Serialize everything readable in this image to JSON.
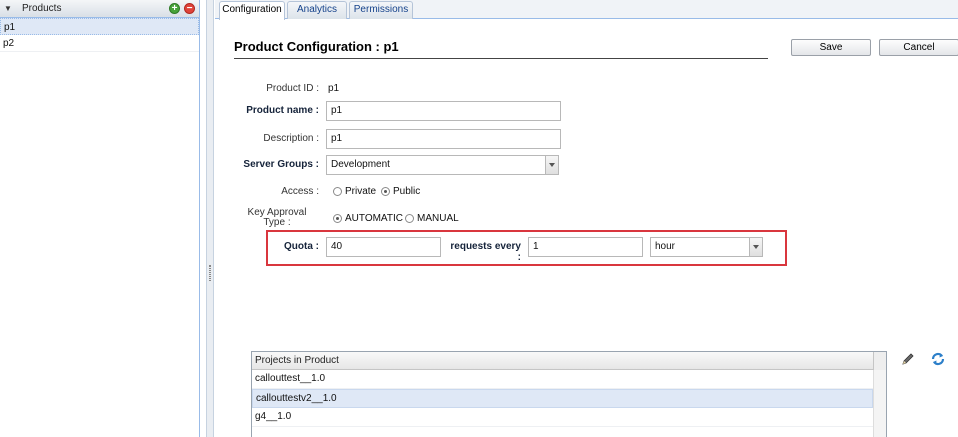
{
  "left_panel": {
    "title": "Products",
    "items": [
      {
        "label": "p1",
        "selected": true
      },
      {
        "label": "p2",
        "selected": false
      }
    ]
  },
  "tabs": [
    {
      "label": "Configuration",
      "active": true
    },
    {
      "label": "Analytics",
      "active": false
    },
    {
      "label": "Permissions",
      "active": false
    }
  ],
  "page": {
    "title": "Product Configuration : p1",
    "save_label": "Save",
    "cancel_label": "Cancel"
  },
  "form": {
    "product_id_label": "Product ID :",
    "product_id_value": "p1",
    "product_name_label": "Product name :",
    "product_name_value": "p1",
    "description_label": "Description :",
    "description_value": "p1",
    "server_groups_label": "Server Groups :",
    "server_groups_value": "Development",
    "access_label": "Access :",
    "access_options": [
      "Private",
      "Public"
    ],
    "access_selected": "Public",
    "key_approval_label_1": "Key Approval",
    "key_approval_label_2": "Type :",
    "key_approval_options": [
      "AUTOMATIC",
      "MANUAL"
    ],
    "key_approval_selected": "AUTOMATIC",
    "quota_label": "Quota :",
    "quota_value": "40",
    "requests_every_label": "requests every :",
    "requests_every_value": "1",
    "unit_value": "hour"
  },
  "projects": {
    "header": "Projects in Product",
    "rows": [
      {
        "label": "callouttest__1.0",
        "selected": false
      },
      {
        "label": "callouttestv2__1.0",
        "selected": true
      },
      {
        "label": "g4__1.0",
        "selected": false
      }
    ]
  },
  "colors": {
    "accent": "#15428b",
    "highlight_border": "#d9363e",
    "selection": "#dfe8f6"
  }
}
